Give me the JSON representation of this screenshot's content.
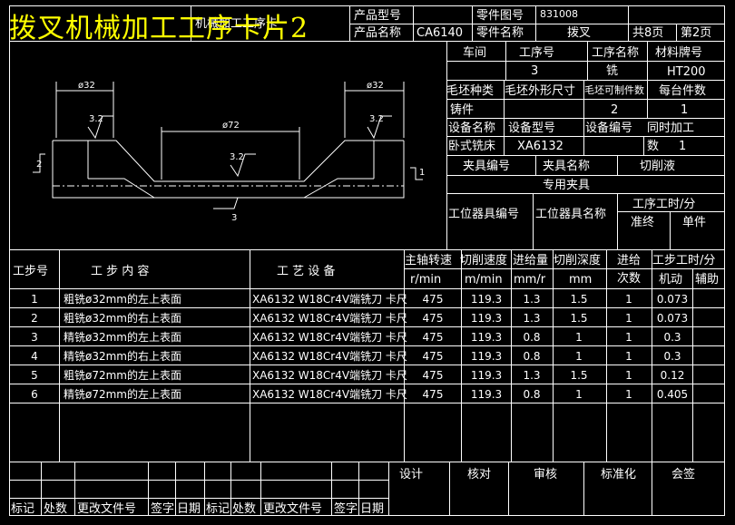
{
  "overlay_title": "拨叉机械加工工序卡片2",
  "header": {
    "card_type": "机械加工工序卡",
    "product_model_label": "产品型号",
    "product_name_label": "产品名称",
    "product_name": "CA6140",
    "part_no_label": "零件图号",
    "part_no": "831008",
    "part_name_label": "零件名称",
    "part_name": "拨叉",
    "total_pages": "共8页",
    "page": "第2页"
  },
  "info": {
    "workshop_label": "车间",
    "op_no_label": "工序号",
    "op_name_label": "工序名称",
    "material_label": "材料牌号",
    "op_no": "3",
    "op_name": "铣",
    "material": "HT200",
    "blank_type_label": "毛坯种类",
    "blank_size_label": "毛坯外形尺寸",
    "blank_count_label": "毛坯可制件数",
    "per_unit_label": "每台件数",
    "blank_type": "铸件",
    "blank_count": "2",
    "per_unit": "1",
    "equip_name_label": "设备名称",
    "equip_model_label": "设备型号",
    "equip_no_label": "设备编号",
    "simul_label": "同时加工",
    "equip_name": "卧式铣床",
    "equip_model": "XA6132",
    "count_label": "数",
    "simul": "1",
    "fixture_no_label": "夹具编号",
    "fixture_name_label": "夹具名称",
    "coolant_label": "切削液",
    "fixture_name": "专用夹具",
    "station_no_label": "工位器具编号",
    "station_name_label": "工位器具名称",
    "time_label": "工序工时/分",
    "prep_label": "准终",
    "unit_label": "单件"
  },
  "drawing": {
    "dim_left": "ø32",
    "dim_right": "ø32",
    "dim_center": "ø72",
    "rough_left": "3.2",
    "rough_right": "3.2",
    "rough_center": "3.2",
    "label_1": "1",
    "label_2": "2",
    "label_3": "3"
  },
  "table": {
    "headers": {
      "step_no": "工步号",
      "content": "工  步  内  容",
      "equipment": "工  艺  设  备",
      "spindle": "主轴转速",
      "speed": "切削速度",
      "feed": "进给量",
      "depth": "切削深度",
      "passes": "进给",
      "passes2": "次数",
      "hours": "工步工时/分",
      "spindle_unit": "r/min",
      "speed_unit": "m/min",
      "feed_unit": "mm/r",
      "depth_unit": "mm",
      "machine": "机动",
      "aux": "辅助"
    },
    "rows": [
      {
        "no": "1",
        "content": "粗铣ø32mm的左上表面",
        "equip": "XA6132  W18Cr4V端铣刀 卡尺",
        "spindle": "475",
        "speed": "119.3",
        "feed": "1.3",
        "depth": "1.5",
        "passes": "1",
        "machine": "0.073"
      },
      {
        "no": "2",
        "content": "粗铣ø32mm的右上表面",
        "equip": "XA6132  W18Cr4V端铣刀 卡尺",
        "spindle": "475",
        "speed": "119.3",
        "feed": "1.3",
        "depth": "1.5",
        "passes": "1",
        "machine": "0.073"
      },
      {
        "no": "3",
        "content": "精铣ø32mm的左上表面",
        "equip": "XA6132  W18Cr4V端铣刀 卡尺",
        "spindle": "475",
        "speed": "119.3",
        "feed": "0.8",
        "depth": "1",
        "passes": "1",
        "machine": "0.3"
      },
      {
        "no": "4",
        "content": "精铣ø32mm的右上表面",
        "equip": "XA6132  W18Cr4V端铣刀 卡尺",
        "spindle": "475",
        "speed": "119.3",
        "feed": "0.8",
        "depth": "1",
        "passes": "1",
        "machine": "0.3"
      },
      {
        "no": "5",
        "content": "粗铣ø72mm的左上表面",
        "equip": "XA6132  W18Cr4V端铣刀 卡尺",
        "spindle": "475",
        "speed": "119.3",
        "feed": "1.3",
        "depth": "1.5",
        "passes": "1",
        "machine": "0.12"
      },
      {
        "no": "6",
        "content": "精铣ø72mm的左上表面",
        "equip": "XA6132  W18Cr4V端铣刀 卡尺",
        "spindle": "475",
        "speed": "119.3",
        "feed": "0.8",
        "depth": "1",
        "passes": "1",
        "machine": "0.405"
      }
    ]
  },
  "footer": {
    "design": "设计",
    "review": "核对",
    "audit": "审核",
    "standard": "标准化",
    "sign": "会签",
    "left": [
      "标记",
      "处数",
      "更改文件号",
      "签字",
      "日期",
      "标记",
      "处数",
      "更改文件号",
      "签字",
      "日期"
    ]
  },
  "colors": {
    "background": "#000000",
    "lines": "#ffffff",
    "overlay": "#ffff00"
  }
}
